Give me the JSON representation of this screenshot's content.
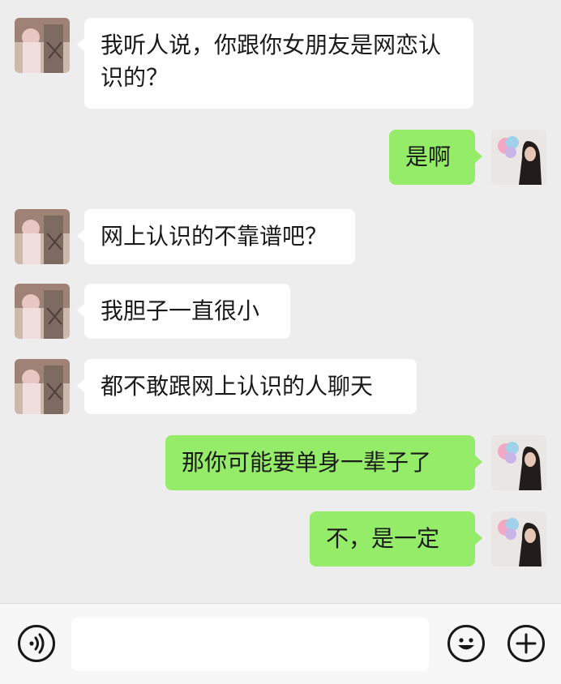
{
  "messages": [
    {
      "side": "left",
      "text": "我听人说，你跟你女朋友是网恋认识的？"
    },
    {
      "side": "right",
      "text": "是啊"
    },
    {
      "side": "left",
      "text": "网上认识的不靠谱吧？"
    },
    {
      "side": "left",
      "text": "我胆子一直很小"
    },
    {
      "side": "left",
      "text": "都不敢跟网上认识的人聊天"
    },
    {
      "side": "right",
      "text": "那你可能要单身一辈子了"
    },
    {
      "side": "right",
      "text": "不，是一定"
    }
  ],
  "input": {
    "value": "",
    "placeholder": ""
  },
  "icons": {
    "voice": "voice-icon",
    "emoji": "emoji-icon",
    "plus": "plus-icon"
  },
  "colors": {
    "background": "#ededed",
    "bubble_left": "#ffffff",
    "bubble_right": "#95ec69",
    "bar": "#f7f7f7"
  }
}
